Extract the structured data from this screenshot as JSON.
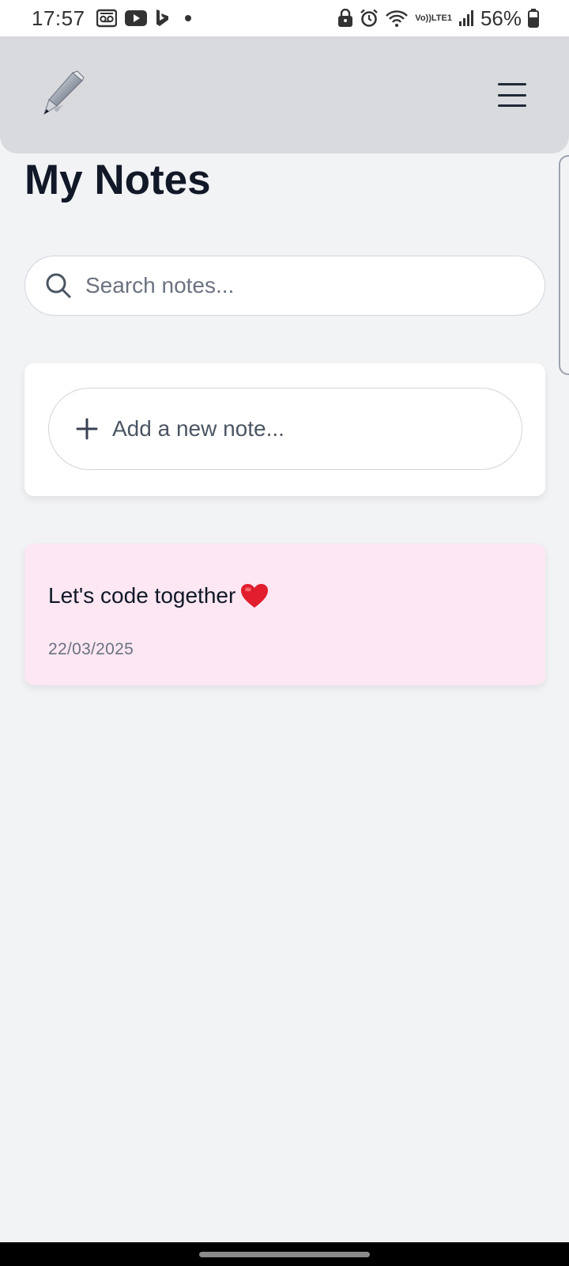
{
  "status_bar": {
    "time": "17:57",
    "battery_percent": "56%",
    "network_label_top": "Vo))",
    "network_label_bottom": "LTE1",
    "left_icons": [
      "voicemail-icon",
      "youtube-icon",
      "bing-icon",
      "notification-dot"
    ],
    "right_icons": [
      "lock-icon",
      "alarm-icon",
      "wifi-icon",
      "signal-icon",
      "battery-icon"
    ]
  },
  "header": {
    "logo_icon": "pen-icon",
    "menu_icon": "hamburger-menu-icon"
  },
  "page": {
    "title": "My Notes"
  },
  "search": {
    "placeholder": "Search notes...",
    "value": ""
  },
  "add_note": {
    "label": "Add a new note..."
  },
  "notes": [
    {
      "text": "Let's code together",
      "emoji": "heart-icon",
      "date": "22/03/2025",
      "color": "#fce7f3"
    }
  ],
  "colors": {
    "background": "#f2f3f5",
    "header": "#d9dadd",
    "title": "#111827",
    "note_pink": "#fce7f3"
  }
}
